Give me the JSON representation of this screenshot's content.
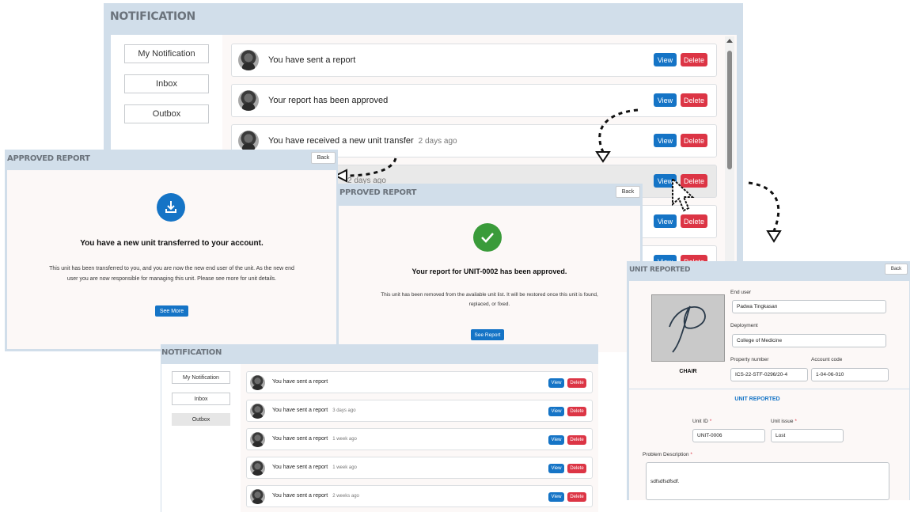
{
  "main": {
    "title": "NOTIFICATION",
    "nav": [
      "My Notification",
      "Inbox",
      "Outbox"
    ],
    "rows": [
      {
        "text": "You have sent a report",
        "ago": ""
      },
      {
        "text": "Your report has been approved",
        "ago": ""
      },
      {
        "text": "You have received a new unit transfer",
        "ago": "2 days ago"
      },
      {
        "text": "",
        "ago": "2 days ago"
      }
    ],
    "view_label": "View",
    "delete_label": "Delete"
  },
  "approved_left": {
    "title": "APPROVED REPORT",
    "back_label": "Back",
    "heading": "You have a new unit transferred to your account.",
    "body_line1": "This unit has been transferred to you, and you are now the new end user of the unit. As the new end",
    "body_line2": "user you are now responsible for managing this unit. Please see more for unit details.",
    "button": "See More"
  },
  "approved_mid": {
    "title": "PPROVED REPORT",
    "back_label": "Back",
    "heading": "Your report for UNIT-0002 has been approved.",
    "body_line1": "This unit has been removed from the available unit list. It will be restored once this unit is found,",
    "body_line2": "replaced, or fixed.",
    "button": "See Report"
  },
  "outbox": {
    "title": "NOTIFICATION",
    "nav": [
      "My Notification",
      "Inbox",
      "Outbox"
    ],
    "rows": [
      {
        "text": "You have sent a report",
        "ago": ""
      },
      {
        "text": "You have sent a report",
        "ago": "3 days ago"
      },
      {
        "text": "You have sent a report",
        "ago": "1 week ago"
      },
      {
        "text": "You have sent a report",
        "ago": "1 week ago"
      },
      {
        "text": "You have sent a report",
        "ago": "2 weeks ago"
      }
    ],
    "view_label": "View",
    "delete_label": "Delete"
  },
  "unit_reported": {
    "title": "UNIT REPORTED",
    "back_label": "Back",
    "item_name": "CHAIR",
    "end_user_label": "End user",
    "end_user": "Padwa Tingkasan",
    "deployment_label": "Deployment",
    "deployment": "College of Medicine",
    "property_label": "Property number",
    "property": "ICS-22-STF-0296/20-4",
    "account_label": "Account code",
    "account": "1-04-06-010",
    "section_title": "UNIT REPORTED",
    "unit_id_label": "Unit ID",
    "unit_id": "UNIT-0006",
    "unit_issue_label": "Unit issue",
    "unit_issue": "Lost",
    "problem_label": "Problem Description",
    "problem": "sdfsdfsdfsdf.",
    "required_mark": "*"
  },
  "colors": {
    "panel": "#d1deea",
    "blue": "#1574c6",
    "red": "#dc3545",
    "green": "#3a9b3a",
    "title_gray": "#6b737c"
  }
}
